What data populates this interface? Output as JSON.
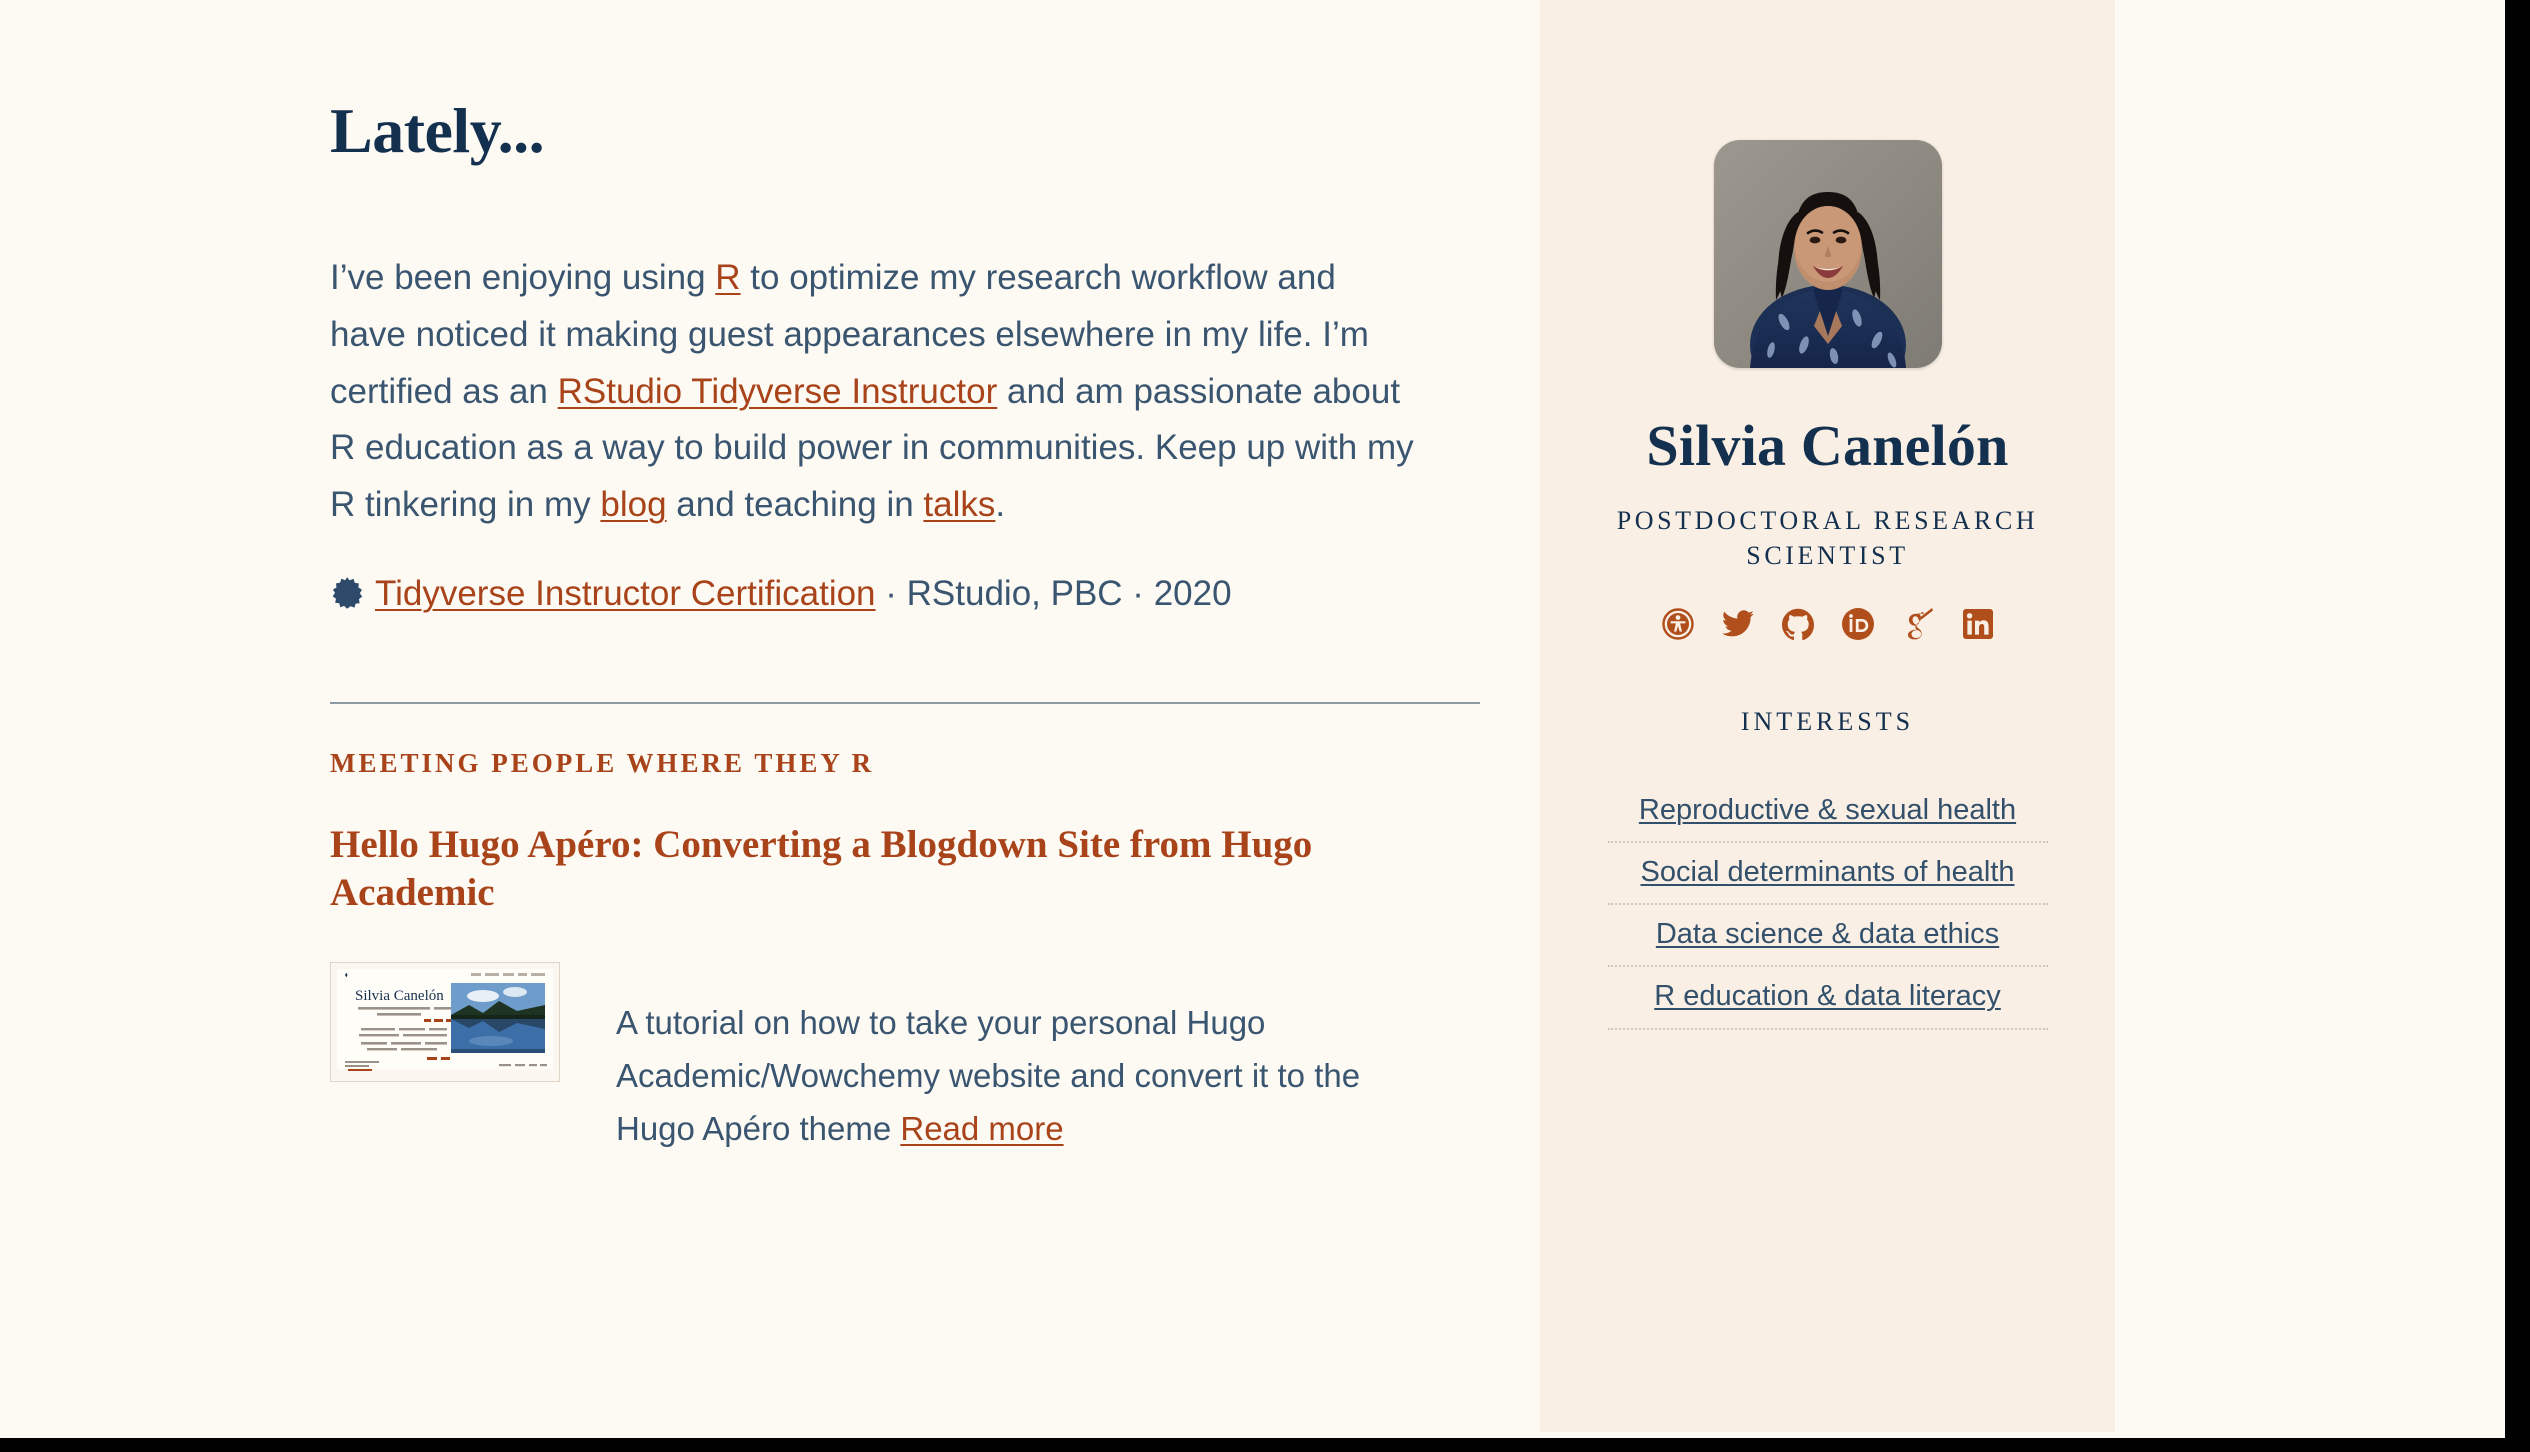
{
  "colors": {
    "page_bg": "#FDFAF4",
    "sidebar_bg": "#F9EFE4",
    "navy": "#14304F",
    "body_text": "#3A5570",
    "link_rust": "#A8431A",
    "interest_link": "#32506B",
    "divider": "#8C9AA6",
    "dotted_rule": "#D8C7B4"
  },
  "main": {
    "title": "Lately...",
    "bio": {
      "part1": "I’ve been enjoying using ",
      "link_r": "R",
      "part2": " to optimize my research workflow and have noticed it making guest appearances elsewhere in my life. I’m certified as an ",
      "link_rstudio": "RStudio Tidyverse Instructor",
      "part3": " and am passionate about R education as a way to build power in communities. Keep up with my R tinkering in my ",
      "link_blog": "blog",
      "part4": " and teaching in ",
      "link_talks": "talks",
      "part5": "."
    },
    "certification": {
      "badge_icon": "certificate-seal-icon",
      "link": "Tidyverse Instructor Certification",
      "separator1": " · ",
      "issuer": "RStudio, PBC",
      "separator2": " · ",
      "year": "2020"
    },
    "post": {
      "category": "Meeting People Where They R",
      "title": "Hello Hugo Apéro: Converting a Blogdown Site from Hugo Academic",
      "thumbnail_alt": "Screenshot of Silvia Canelón website with lake reflection photo",
      "thumbnail_heading": "Silvia Canelón",
      "summary_text": "A tutorial on how to take your personal Hugo Academic/Wowchemy website and convert it to the Hugo Apéro theme ",
      "read_more": "Read more"
    }
  },
  "sidebar": {
    "avatar_alt": "Portrait of Silvia Canelón",
    "name": "Silvia Canelón",
    "role": "Postdoctoral Research Scientist",
    "social": [
      {
        "name": "accessibility-icon",
        "label": "Accessibility"
      },
      {
        "name": "twitter-icon",
        "label": "Twitter"
      },
      {
        "name": "github-icon",
        "label": "GitHub"
      },
      {
        "name": "orcid-icon",
        "label": "ORCID"
      },
      {
        "name": "google-scholar-icon",
        "label": "Google Scholar"
      },
      {
        "name": "linkedin-icon",
        "label": "LinkedIn"
      }
    ],
    "interests_heading": "Interests",
    "interests": [
      "Reproductive & sexual health",
      "Social determinants of health",
      "Data science & data ethics",
      "R education & data literacy"
    ]
  }
}
